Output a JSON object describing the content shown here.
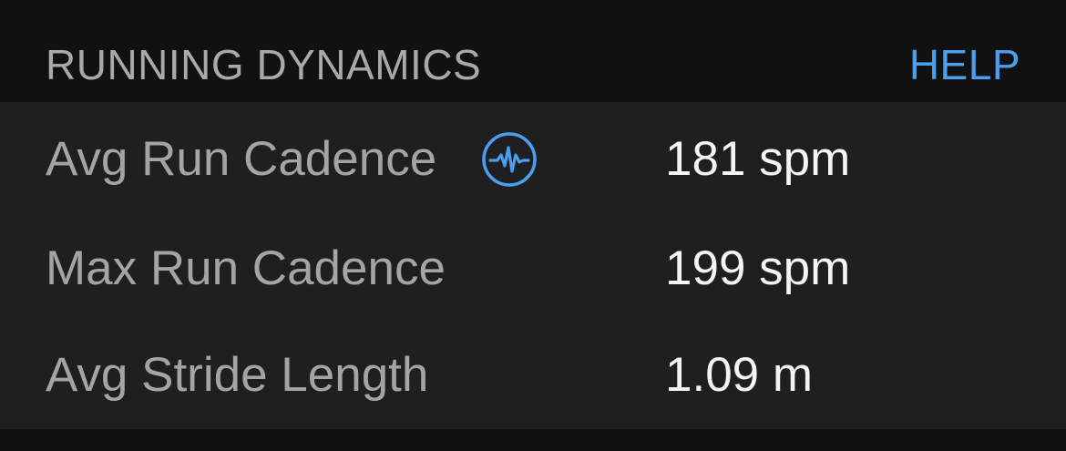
{
  "section": {
    "title": "RUNNING DYNAMICS",
    "help_label": "HELP"
  },
  "colors": {
    "background": "#111111",
    "card": "#1f1f1f",
    "label": "#a4a4a4",
    "value": "#f4f4f4",
    "accent": "#4a9ff0"
  },
  "metrics": [
    {
      "label": "Avg Run Cadence",
      "value": "181 spm",
      "icon": "heart-rate-pulse-icon"
    },
    {
      "label": "Max Run Cadence",
      "value": "199 spm"
    },
    {
      "label": "Avg Stride Length",
      "value": "1.09 m"
    }
  ]
}
